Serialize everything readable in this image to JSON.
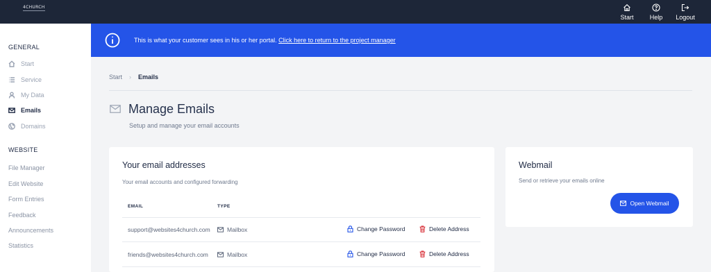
{
  "topbar": {
    "logo_text": "4CHURCH",
    "nav": [
      {
        "label": "Start",
        "icon": "home-icon"
      },
      {
        "label": "Help",
        "icon": "help-icon"
      },
      {
        "label": "Logout",
        "icon": "logout-icon"
      }
    ]
  },
  "sidebar": {
    "general_heading": "GENERAL",
    "general_items": [
      {
        "label": "Start",
        "icon": "home-icon"
      },
      {
        "label": "Service",
        "icon": "list-icon"
      },
      {
        "label": "My Data",
        "icon": "user-icon"
      },
      {
        "label": "Emails",
        "icon": "mail-icon",
        "active": true
      },
      {
        "label": "Domains",
        "icon": "globe-icon"
      }
    ],
    "website_heading": "WEBSITE",
    "website_items": [
      "File Manager",
      "Edit Website",
      "Form Entries",
      "Feedback",
      "Announcements",
      "Statistics"
    ]
  },
  "banner": {
    "text": "This is what your customer sees in his or her portal. ",
    "link": "Click here to return to the project manager"
  },
  "breadcrumb": {
    "start": "Start",
    "separator": "›",
    "current": "Emails"
  },
  "page": {
    "title": "Manage Emails",
    "subtitle": "Setup and manage your email accounts"
  },
  "emails_card": {
    "title": "Your email addresses",
    "description": "Your email accounts and configured forwarding",
    "columns": {
      "email": "EMAIL",
      "type": "TYPE"
    },
    "rows": [
      {
        "email": "support@websites4church.com",
        "type": "Mailbox",
        "change": "Change Password",
        "delete": "Delete Address"
      },
      {
        "email": "friends@websites4church.com",
        "type": "Mailbox",
        "change": "Change Password",
        "delete": "Delete Address"
      }
    ]
  },
  "webmail_card": {
    "title": "Webmail",
    "description": "Send or retrieve your emails online",
    "button": "Open Webmail"
  },
  "colors": {
    "topbar": "#1d2638",
    "accent": "#2454e8",
    "delete": "#d9363e"
  }
}
